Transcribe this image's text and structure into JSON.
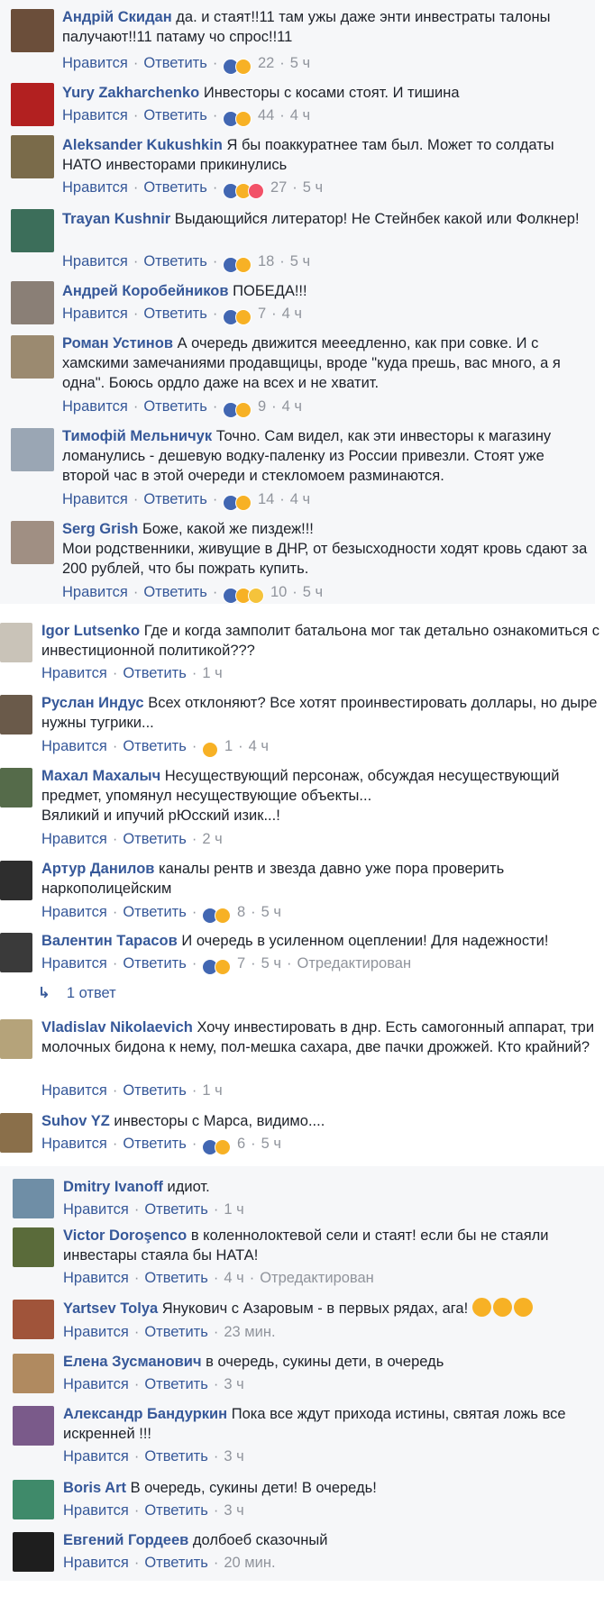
{
  "labels": {
    "like": "Нравится",
    "reply": "Ответить"
  },
  "colors": {
    "link": "#365899",
    "meta": "#90949c",
    "text": "#1d2129",
    "thread_bg": "#f6f7f9"
  },
  "thread1": [
    {
      "name": "Андрій Скидан",
      "text": "да. и стаят!!11 там ужы даже энти инвестраты талоны палучают!!11 патаму чо спрос!!11",
      "reactions": [
        "like",
        "haha"
      ],
      "count": "22",
      "time": "5 ч"
    },
    {
      "name": "Yury Zakharchenko",
      "text": "Инвесторы с косами стоят. И тишина",
      "reactions": [
        "like",
        "haha"
      ],
      "count": "44",
      "time": "4 ч"
    },
    {
      "name": "Aleksander Kukushkin",
      "text": "Я бы поаккуратнее там был. Может то солдаты НАТО инвесторами прикинулись",
      "reactions": [
        "like",
        "haha",
        "love"
      ],
      "count": "27",
      "time": "5 ч"
    },
    {
      "name": "Trayan Kushnir",
      "text": "Выдающийся литератор! Не Стейнбек какой или Фолкнер!",
      "reactions": [
        "like",
        "haha"
      ],
      "count": "18",
      "time": "5 ч"
    },
    {
      "name": "Андрей Коробейников",
      "text": "ПОБЕДА!!!",
      "reactions": [
        "like",
        "haha"
      ],
      "count": "7",
      "time": "4 ч"
    },
    {
      "name": "Роман Устинов",
      "text": "А очередь движится мееедленно, как при совке. И с хамскими замечаниями продавщицы, вроде \"куда прешь, вас много, а я одна\". Боюсь ордло даже на всех и не хватит.",
      "reactions": [
        "like",
        "haha"
      ],
      "count": "9",
      "time": "4 ч"
    },
    {
      "name": "Тимофій Мельничук",
      "text": "Точно. Сам видел, как эти инвесторы к магазину ломанулись - дешевую водку-паленку из России привезли. Стоят уже второй час в этой очереди и стекломоем разминаются.",
      "reactions": [
        "like",
        "haha"
      ],
      "count": "14",
      "time": "4 ч"
    },
    {
      "name": "Serg Grish",
      "text": "Боже, какой же пиздеж!!!\nМои родственники, живущие в ДНР, от безысходности ходят кровь сдают за 200 рублей, что бы пожрать купить.",
      "reactions": [
        "like",
        "haha",
        "wow"
      ],
      "count": "10",
      "time": "5 ч"
    }
  ],
  "thread2": [
    {
      "name": "Igor Lutsenko",
      "text": "Где и когда замполит батальона мог так детально ознакомиться с инвестиционной политикой???",
      "reactions": [],
      "count": "",
      "time": "1 ч"
    },
    {
      "name": "Руслан Индус",
      "text": "Всех отклоняют? Все хотят проинвестировать доллары, но дыре нужны тугрики...",
      "reactions": [
        "haha"
      ],
      "count": "1",
      "time": "4 ч"
    },
    {
      "name": "Махал Махалыч",
      "text": "Несуществующий персонаж, обсуждая несуществующий предмет, упомянул несуществующие объекты...\nВяликий и ипучий рЮсский изик...!",
      "reactions": [],
      "count": "",
      "time": "2 ч"
    },
    {
      "name": "Артур Данилов",
      "text": "каналы рентв и звезда давно уже пора проверить наркополицейским",
      "reactions": [
        "like",
        "haha"
      ],
      "count": "8",
      "time": "5 ч"
    },
    {
      "name": "Валентин Тарасов",
      "text": "И очередь в усиленном оцеплении! Для надежности!",
      "reactions": [
        "like",
        "haha"
      ],
      "count": "7",
      "time": "5 ч",
      "edited": "Отредактирован",
      "replies": "1 ответ"
    },
    {
      "name": "Vladislav Nikolaevich",
      "text": "Хочу инвестировать в днр. Есть самогонный аппарат, три молочных бидона к нему, пол-мешка сахара, две пачки дрожжей. Кто крайний?",
      "reactions": [],
      "count": "",
      "time": "1 ч"
    },
    {
      "name": "Suhov YZ",
      "text": "инвесторы с Марса, видимо....",
      "reactions": [
        "like",
        "haha"
      ],
      "count": "6",
      "time": "5 ч"
    }
  ],
  "thread3": [
    {
      "name": "Dmitry Ivanoff",
      "text": "идиот.",
      "reactions": [],
      "count": "",
      "time": "1 ч"
    },
    {
      "name": "Victor Doroşenco",
      "text": "в коленнолоктевой сели и стаят! если бы не стаяли инвестары стаяла бы НАТА!",
      "reactions": [],
      "count": "",
      "time": "4 ч",
      "edited": "Отредактирован"
    },
    {
      "name": "Yartsev Tolya",
      "text": "Янукович с Азаровым - в первых рядах, ага!",
      "emoji_count": 3,
      "reactions": [],
      "count": "",
      "time": "23 мин."
    },
    {
      "name": "Елена Зусманович",
      "text": "в очередь, сукины дети, в очередь",
      "reactions": [],
      "count": "",
      "time": "3 ч"
    },
    {
      "name": "Александр Бандуркин",
      "text": "Пока все ждут прихода истины, святая ложь все искренней !!!",
      "reactions": [],
      "count": "",
      "time": "3 ч"
    },
    {
      "name": "Boris Art",
      "text": "В очередь, сукины дети! В очередь!",
      "reactions": [],
      "count": "",
      "time": "3 ч"
    },
    {
      "name": "Евгений Гордеев",
      "text": "долбоеб сказочный",
      "reactions": [],
      "count": "",
      "time": "20 мин."
    }
  ]
}
